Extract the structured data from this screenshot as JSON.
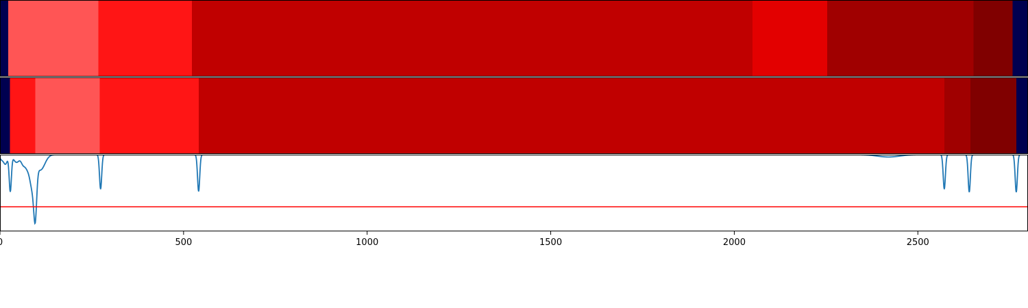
{
  "chart_data": [
    {
      "type": "heatmap",
      "xlim": [
        0,
        2800
      ],
      "outside_color": "#000050",
      "segments": [
        {
          "start": 0,
          "end": 22,
          "color": "#000050"
        },
        {
          "start": 22,
          "end": 268,
          "color": "#ff5555"
        },
        {
          "start": 268,
          "end": 523,
          "color": "#ff1515"
        },
        {
          "start": 523,
          "end": 2050,
          "color": "#c00000"
        },
        {
          "start": 2050,
          "end": 2253,
          "color": "#e30000"
        },
        {
          "start": 2253,
          "end": 2652,
          "color": "#a00000"
        },
        {
          "start": 2652,
          "end": 2758,
          "color": "#800000"
        },
        {
          "start": 2758,
          "end": 2800,
          "color": "#000050"
        }
      ]
    },
    {
      "type": "heatmap",
      "xlim": [
        0,
        2800
      ],
      "outside_color": "#000050",
      "segments": [
        {
          "start": 0,
          "end": 27,
          "color": "#000050"
        },
        {
          "start": 27,
          "end": 96,
          "color": "#ff1515"
        },
        {
          "start": 96,
          "end": 272,
          "color": "#ff5555"
        },
        {
          "start": 272,
          "end": 541,
          "color": "#ff1515"
        },
        {
          "start": 541,
          "end": 2572,
          "color": "#c00000"
        },
        {
          "start": 2572,
          "end": 2643,
          "color": "#a00000"
        },
        {
          "start": 2643,
          "end": 2768,
          "color": "#800000"
        },
        {
          "start": 2768,
          "end": 2800,
          "color": "#000050"
        }
      ]
    },
    {
      "type": "line",
      "xlim": [
        0,
        2800
      ],
      "ylim": [
        0,
        1
      ],
      "x_ticks": [
        0,
        500,
        1000,
        1500,
        2000,
        2500
      ],
      "threshold": {
        "value": 0.32,
        "color": "#ff0000"
      },
      "series": [
        {
          "color": "#1f77b4",
          "baseline": 1.0,
          "dips": [
            {
              "center": 4,
              "depth": 0.06,
              "width": 5
            },
            {
              "center": 15,
              "depth": 0.12,
              "width": 5
            },
            {
              "center": 28,
              "depth": 0.47,
              "width": 3
            },
            {
              "center": 45,
              "depth": 0.1,
              "width": 8
            },
            {
              "center": 62,
              "depth": 0.08,
              "width": 5
            },
            {
              "center": 75,
              "depth": 0.18,
              "width": 8
            },
            {
              "center": 88,
              "depth": 0.35,
              "width": 6
            },
            {
              "center": 96,
              "depth": 0.64,
              "width": 4
            },
            {
              "center": 110,
              "depth": 0.2,
              "width": 12
            },
            {
              "center": 274,
              "depth": 0.45,
              "width": 3
            },
            {
              "center": 541,
              "depth": 0.48,
              "width": 3
            },
            {
              "center": 2420,
              "depth": 0.03,
              "width": 30
            },
            {
              "center": 2572,
              "depth": 0.45,
              "width": 3
            },
            {
              "center": 2640,
              "depth": 0.49,
              "width": 3
            },
            {
              "center": 2768,
              "depth": 0.49,
              "width": 3
            }
          ]
        }
      ]
    }
  ]
}
